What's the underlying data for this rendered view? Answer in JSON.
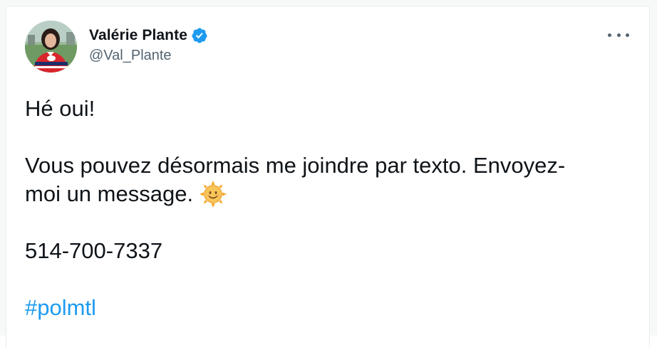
{
  "tweet": {
    "author": {
      "display_name": "Valérie Plante",
      "handle": "@Val_Plante",
      "verified": true,
      "avatar_icon": "profile-photo"
    },
    "menu_icon": "more-icon",
    "text": {
      "line1": "Hé oui!",
      "line2": "Vous pouvez désormais me joindre par texto. Envoyez-",
      "line3": "moi un message.",
      "emoji": "smiling-sun-emoji",
      "phone": "514-700-7337",
      "hashtag": "#polmtl"
    },
    "colors": {
      "text": "#0f1419",
      "secondary": "#536471",
      "link": "#1d9bf0",
      "verified": "#1d9bf0"
    }
  }
}
